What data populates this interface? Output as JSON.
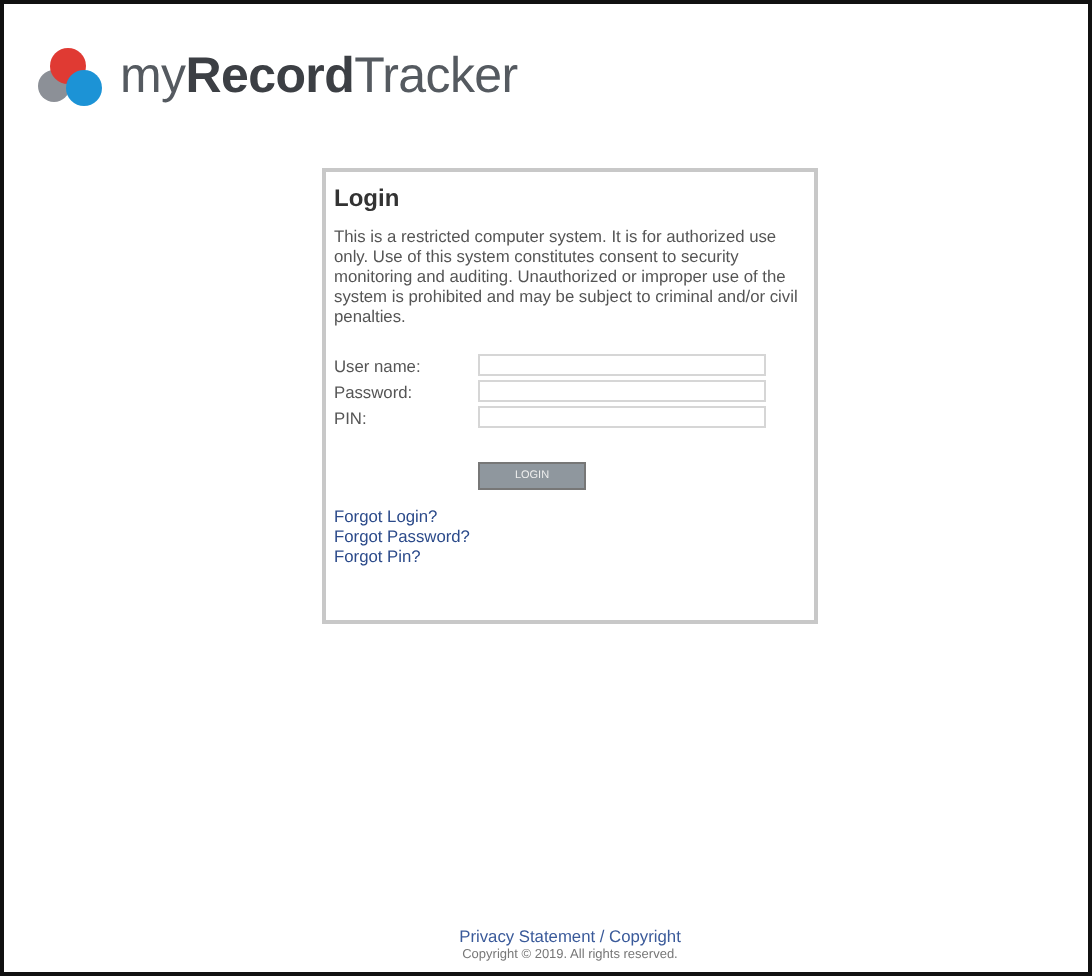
{
  "logo": {
    "text": "my**Record**Tracker"
  },
  "login": {
    "title": "Login",
    "notice": "This is a restricted computer system. It is for authorized use only. Use of this system constitutes consent to security monitoring and auditing. Unauthorized or improper use of the system is prohibited and may be subject to criminal and/or civil penalties.",
    "fields": [
      {
        "label": "User name:"
      },
      {
        "label": "Password:"
      },
      {
        "label": "PIN:"
      }
    ],
    "button": "LOGIN",
    "links": [
      "Forgot Login?",
      "Forgot Password?",
      "Forgot Pin?"
    ]
  },
  "footer": {
    "link": "Privacy Statement / Copyright",
    "copyright": "Copyright © 2019. All rights reserved."
  }
}
